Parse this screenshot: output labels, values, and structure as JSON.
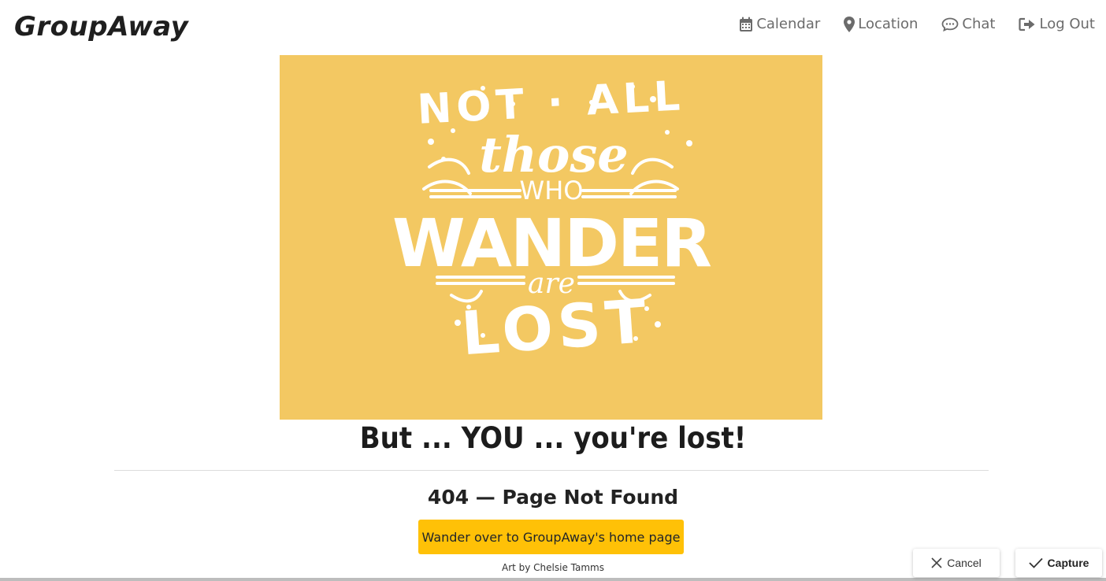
{
  "brand": {
    "name": "GroupAway"
  },
  "nav": {
    "items": [
      {
        "label": "Calendar",
        "icon": "calendar-icon"
      },
      {
        "label": "Location",
        "icon": "map-marker-icon"
      },
      {
        "label": "Chat",
        "icon": "chat-bubble-icon"
      },
      {
        "label": "Log Out",
        "icon": "sign-out-icon"
      }
    ]
  },
  "hero": {
    "lettering": "NOT ALL those WHO WANDER are LOST",
    "background": "#f3c862"
  },
  "main": {
    "headline": "But ... YOU ... you're lost!",
    "subhead": "404 — Page Not Found",
    "home_button": "Wander over to GroupAway's home page",
    "credit": "Art by Chelsie Tamms"
  },
  "capture_bar": {
    "cancel_label": "Cancel",
    "capture_label": "Capture"
  },
  "colors": {
    "accent": "#ffc107",
    "nav_text": "#6b6b6b"
  }
}
